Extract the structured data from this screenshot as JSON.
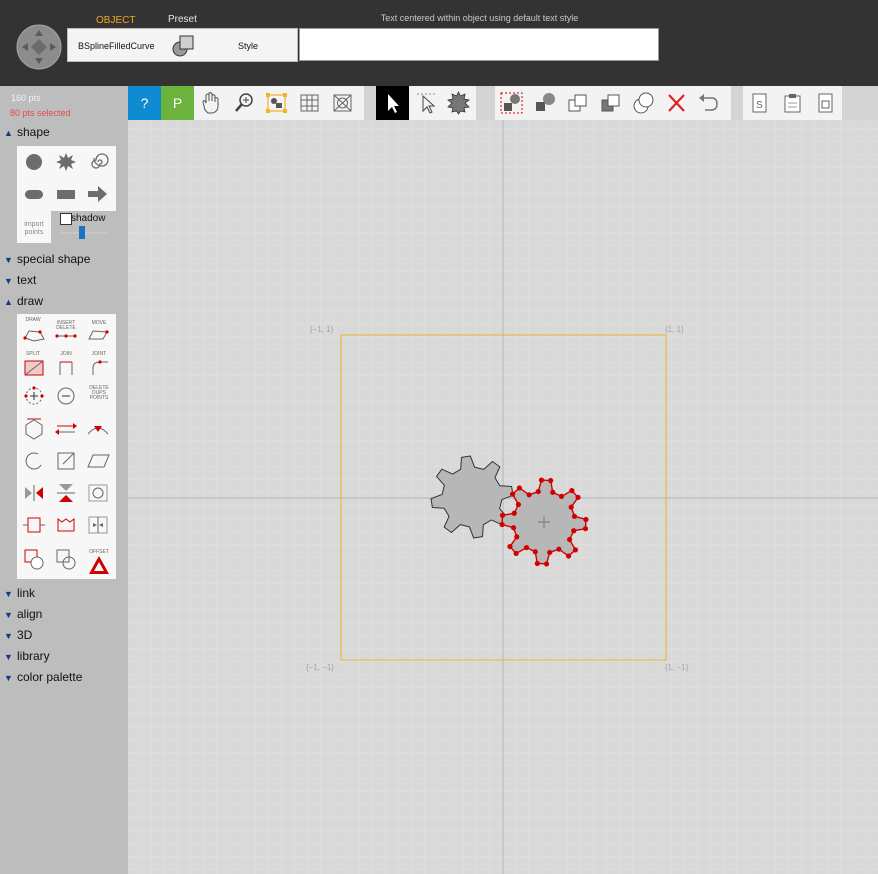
{
  "header": {
    "object_label": "OBJECT",
    "preset_label": "Preset",
    "object_name": "BSplineFilledCurve",
    "style_label": "Style",
    "hint_text": "Text centered within object using default text style",
    "text_input_value": ""
  },
  "sidebar": {
    "points_count": "160 pts",
    "points_selected": "80 pts selected",
    "sections": {
      "shape": "shape",
      "special_shape": "special shape",
      "text": "text",
      "draw": "draw",
      "link": "link",
      "align": "align",
      "three_d": "3D",
      "library": "library",
      "color_palette": "color palette"
    },
    "shape_tools": [
      "circle-icon",
      "star-burst-icon",
      "spiral-icon",
      "rounded-rect-icon",
      "rectangle-icon",
      "arrow-icon"
    ],
    "import_points": "import points",
    "shadow_label": "shadow",
    "shadow_checked": false,
    "shadow_slider_value": 0.45,
    "draw_tool_labels": {
      "draw": "DRAW",
      "insert_delete": "INSERT DELETE",
      "move": "MOVE",
      "split": "SPLIT",
      "join": "JOIN",
      "joint": "JOINT",
      "delete_dups": "DELETE DUPS POINTS",
      "offset": "OFFSET"
    }
  },
  "toolbar": {
    "help_label": "?",
    "p_label": "P",
    "icons": [
      "hand-icon",
      "zoom-icon",
      "select-bounds-icon",
      "grid-icon",
      "target-icon",
      "pointer-icon",
      "point-select-icon",
      "gear-shape-icon",
      "group-select-icon",
      "fill-square-icon",
      "bring-front-icon",
      "send-back-icon",
      "overlap-circles-icon",
      "delete-x-icon",
      "undo-icon",
      "doc-s-icon",
      "clipboard-icon",
      "doc-copy-icon"
    ],
    "colors": {
      "help": "#0e8bd1",
      "p": "#6cb33e",
      "active_pointer": "#000000",
      "delete": "#e02020"
    }
  },
  "canvas": {
    "corner_top_left": "{−1, 1}",
    "corner_top_right": "{1, 1}",
    "corner_bottom_left": "{−1, −1}",
    "corner_bottom_right": "{1, −1}",
    "frame_color": "#f0b428",
    "selection_color": "#d10000",
    "gear_fill": "#b7b7b7"
  }
}
